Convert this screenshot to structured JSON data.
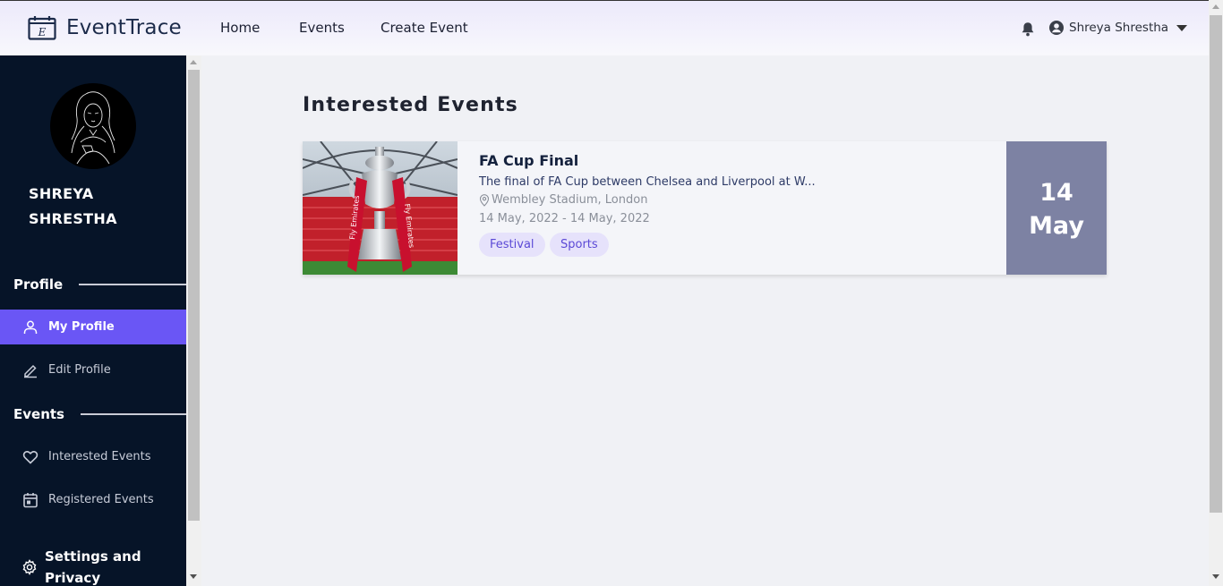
{
  "app": {
    "brand": "EventTrace"
  },
  "nav": {
    "home": "Home",
    "events": "Events",
    "create_event": "Create Event"
  },
  "user": {
    "name": "Shreya Shrestha",
    "full_name_upper": "SHREYA SHRESTHA"
  },
  "sidebar": {
    "profile_section": "Profile",
    "my_profile": "My Profile",
    "edit_profile": "Edit Profile",
    "events_section": "Events",
    "interested_events": "Interested Events",
    "registered_events": "Registered Events",
    "settings": "Settings and Privacy"
  },
  "main": {
    "title": "Interested Events",
    "events": [
      {
        "title": "FA Cup Final",
        "description": "The final of FA Cup between Chelsea and Liverpool at W...",
        "location": "Wembley Stadium, London",
        "date_range": "14 May, 2022 - 14 May, 2022",
        "tags": [
          "Festival",
          "Sports"
        ],
        "day": "14",
        "month": "May"
      }
    ]
  },
  "colors": {
    "accent": "#6a56f5",
    "sidebar_bg": "#061428",
    "date_box": "#7d82a3",
    "tag_bg": "#e6e2fb"
  }
}
